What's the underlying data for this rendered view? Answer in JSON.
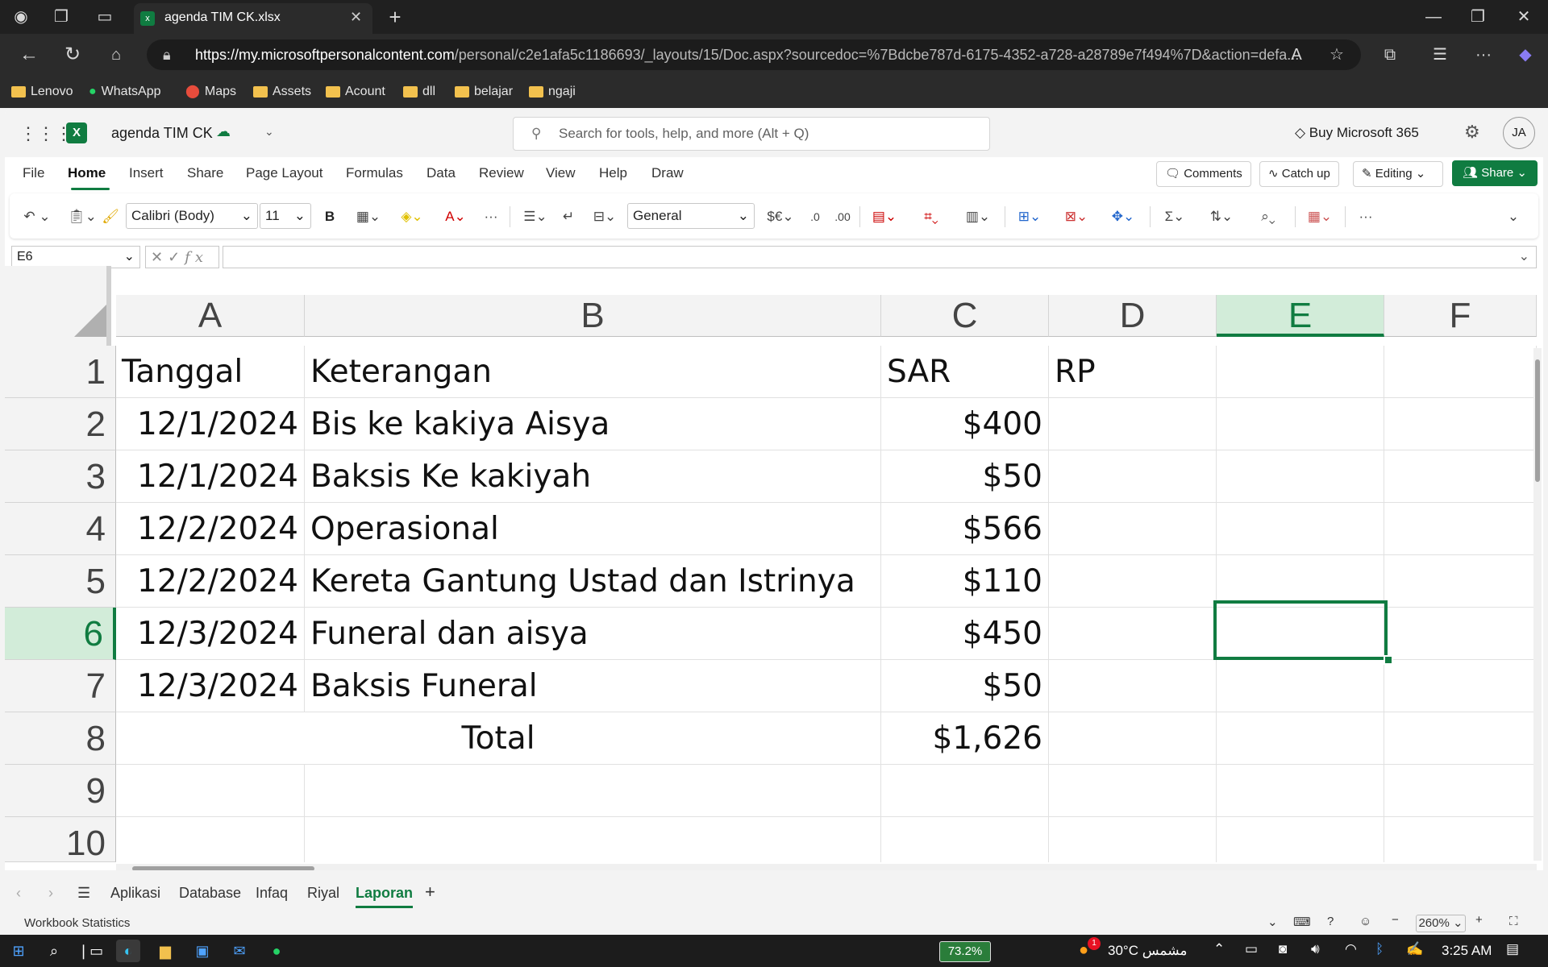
{
  "browser": {
    "tab_title": "agenda TIM CK.xlsx",
    "url_domain": "https://my.microsoftpersonalcontent.com",
    "url_rest": "/personal/c2e1afa5c1186693/_layouts/15/Doc.aspx?sourcedoc=%7Bdcbe787d-6175-4352-a728-a28789e7f494%7D&action=defa...",
    "bookmarks": [
      "Lenovo",
      "WhatsApp",
      "Maps",
      "Assets",
      "Acount",
      "dll",
      "belajar",
      "ngaji"
    ]
  },
  "app": {
    "doc_title": "agenda TIM CK",
    "search_placeholder": "Search for tools, help, and more (Alt + Q)",
    "buy_label": "Buy Microsoft 365",
    "avatar": "JA",
    "menu": [
      "File",
      "Home",
      "Insert",
      "Share",
      "Page Layout",
      "Formulas",
      "Data",
      "Review",
      "View",
      "Help",
      "Draw"
    ],
    "comments_label": "Comments",
    "catchup_label": "Catch up",
    "editing_label": "Editing",
    "share_label": "Share",
    "font_name": "Calibri (Body)",
    "font_size": "11",
    "number_format": "General",
    "name_box": "E6"
  },
  "sheet": {
    "columns": [
      "A",
      "B",
      "C",
      "D",
      "E",
      "F"
    ],
    "rows": [
      "1",
      "2",
      "3",
      "4",
      "5",
      "6",
      "7",
      "8",
      "9",
      "10"
    ],
    "header": {
      "a": "Tanggal",
      "b": "Keterangan",
      "c": "SAR",
      "d": "RP"
    },
    "data": [
      {
        "date": "12/1/2024",
        "desc": "Bis ke kakiya Aisya",
        "sar": "$400"
      },
      {
        "date": "12/1/2024",
        "desc": "Baksis Ke kakiyah",
        "sar": "$50"
      },
      {
        "date": "12/2/2024",
        "desc": "Operasional",
        "sar": "$566"
      },
      {
        "date": "12/2/2024",
        "desc": "Kereta Gantung Ustad dan Istrinya",
        "sar": "$110"
      },
      {
        "date": "12/3/2024",
        "desc": "Funeral dan aisya",
        "sar": "$450"
      },
      {
        "date": "12/3/2024",
        "desc": "Baksis Funeral",
        "sar": "$50"
      }
    ],
    "total_label": "Total",
    "total_value": "$1,626"
  },
  "sheet_tabs": [
    "Aplikasi",
    "Database",
    "Infaq",
    "Riyal",
    "Laporan"
  ],
  "status": {
    "left": "Workbook Statistics",
    "zoom": "260%"
  },
  "taskbar": {
    "battery": "73.2%",
    "weather": "30°C  مشمس",
    "time": "3:25 AM",
    "notification_count": "1"
  }
}
